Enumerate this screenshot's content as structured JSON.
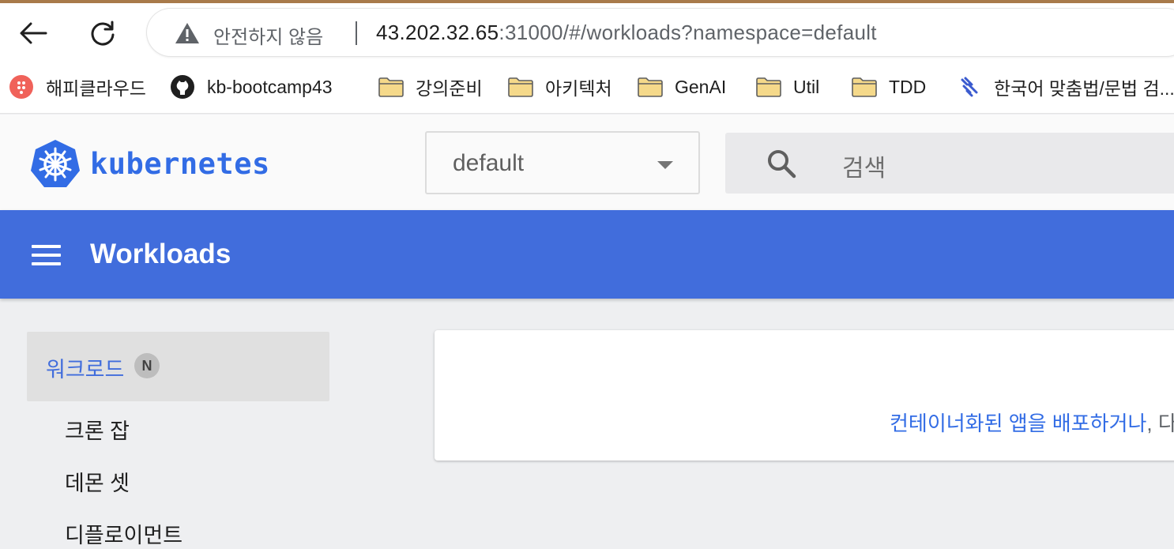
{
  "browser": {
    "security_label": "안전하지 않음",
    "url_host": "43.202.32.65",
    "url_rest": ":31000/#/workloads?namespace=default"
  },
  "bookmarks": [
    {
      "label": "해피클라우드",
      "icon": "happycloud-icon"
    },
    {
      "label": "kb-bootcamp43",
      "icon": "github-icon"
    },
    {
      "label": "강의준비",
      "icon": "folder-icon"
    },
    {
      "label": "아키텍처",
      "icon": "folder-icon"
    },
    {
      "label": "GenAI",
      "icon": "folder-icon"
    },
    {
      "label": "Util",
      "icon": "folder-icon"
    },
    {
      "label": "TDD",
      "icon": "folder-icon"
    },
    {
      "label": "한국어 맞춤법/문법 검...",
      "icon": "speller-icon"
    }
  ],
  "header": {
    "logo_text": "kubernetes",
    "namespace": "default",
    "search_placeholder": "검색"
  },
  "titlebar": {
    "title": "Workloads"
  },
  "sidebar": {
    "active": {
      "label": "워크로드",
      "badge": "N"
    },
    "items": [
      {
        "label": "크론 잡"
      },
      {
        "label": "데몬 셋"
      },
      {
        "label": "디플로이먼트"
      }
    ]
  },
  "main": {
    "empty_text": "컨테이너화된 앱을 배포하거나",
    "empty_text_tail": ", 다"
  },
  "colors": {
    "accent": "#416ddc",
    "k8s_blue": "#326ce5"
  }
}
